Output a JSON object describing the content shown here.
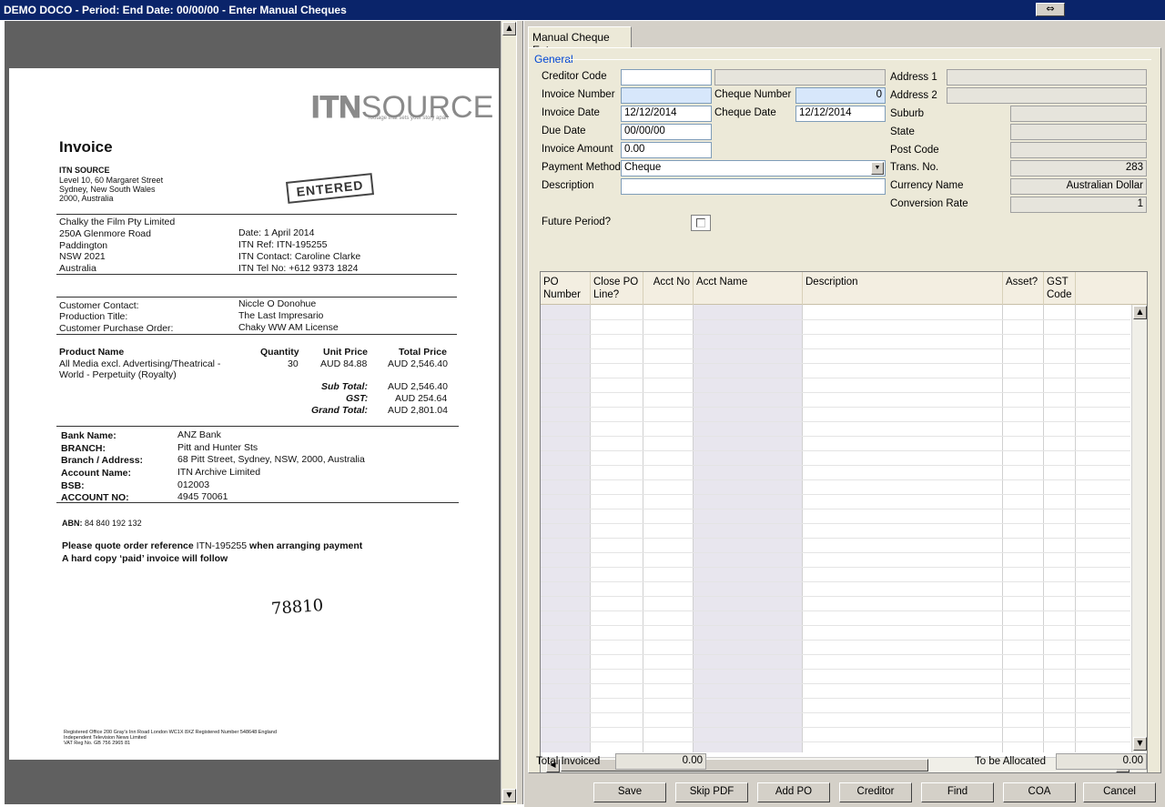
{
  "window": {
    "title": "DEMO DOCO  - Period:   End Date: 00/00/00 - Enter Manual Cheques",
    "swap_icon": "⇔"
  },
  "pdf": {
    "logo_itn": "ITN",
    "logo_source": "SOURCE",
    "logo_tagline": "footage that sets your story apart",
    "heading": "Invoice",
    "company": "ITN SOURCE",
    "company_addr": [
      "Level 10, 60 Margaret Street",
      "Sydney, New South Wales",
      "2000, Australia"
    ],
    "stamp": "ENTERED",
    "billto": [
      "Chalky the Film Pty Limited",
      "250A Glenmore Road",
      "Paddington",
      "NSW 2021",
      "Australia"
    ],
    "meta": [
      "Date: 1 April 2014",
      "ITN Ref: ITN-195255",
      "ITN Contact: Caroline Clarke",
      "ITN Tel No: +612 9373 1824"
    ],
    "contact_labels": [
      "Customer Contact:",
      "Production Title:",
      "Customer Purchase Order:"
    ],
    "contact_values": [
      "Niccle O Donohue",
      "The Last Impresario",
      "Chaky WW AM License"
    ],
    "product_headers": [
      "Product Name",
      "Quantity",
      "Unit Price",
      "Total Price"
    ],
    "product_name": [
      "All Media excl. Advertising/Theatrical -",
      "World - Perpetuity (Royalty)"
    ],
    "product_qty": "30",
    "product_unit": "AUD 84.88",
    "product_total": "AUD 2,546.40",
    "totals_labels": [
      "Sub Total:",
      "GST:",
      "Grand Total:"
    ],
    "totals_values": [
      "AUD 2,546.40",
      "AUD 254.64",
      "AUD 2,801.04"
    ],
    "bank_labels": [
      "Bank Name:",
      "BRANCH:",
      "Branch / Address:",
      "Account Name:",
      "BSB:",
      "ACCOUNT NO:"
    ],
    "bank_values": [
      "ANZ Bank",
      "Pitt and Hunter Sts",
      "68 Pitt Street, Sydney, NSW, 2000, Australia",
      "ITN Archive Limited",
      "012003",
      "4945 70061"
    ],
    "abn_label": "ABN:",
    "abn": "84 840 192 132",
    "note1_a": "Please quote order reference ",
    "note1_b": "ITN-195255",
    "note1_c": " when arranging payment",
    "note2": "A hard copy ‘paid’ invoice will follow",
    "handwritten": "78810",
    "footer": [
      "Registered Office 200 Gray's Inn Road London WC1X 8XZ  Registered Number 548648 England",
      "Independent Television News Limited",
      "VAT Reg No. GB 756 2965 81"
    ]
  },
  "form": {
    "tab_label": "Manual Cheque Entry",
    "group_label": "General",
    "creditor_code": {
      "label": "Creditor Code",
      "value": "",
      "name": ""
    },
    "invoice_number": {
      "label": "Invoice Number",
      "value": ""
    },
    "cheque_number": {
      "label": "Cheque Number",
      "value": "0"
    },
    "invoice_date": {
      "label": "Invoice Date",
      "value": "12/12/2014"
    },
    "cheque_date": {
      "label": "Cheque Date",
      "value": "12/12/2014"
    },
    "due_date": {
      "label": "Due Date",
      "value": "00/00/00"
    },
    "invoice_amount": {
      "label": "Invoice Amount",
      "value": "0.00"
    },
    "payment_method": {
      "label": "Payment Method",
      "value": "Cheque"
    },
    "description": {
      "label": "Description",
      "value": ""
    },
    "future_period": {
      "label": "Future Period?"
    },
    "address1": {
      "label": "Address 1",
      "value": ""
    },
    "address2": {
      "label": "Address 2",
      "value": ""
    },
    "suburb": {
      "label": "Suburb",
      "value": ""
    },
    "state": {
      "label": "State",
      "value": ""
    },
    "post_code": {
      "label": "Post Code",
      "value": ""
    },
    "trans_no": {
      "label": "Trans. No.",
      "value": "283"
    },
    "currency_name": {
      "label": "Currency Name",
      "value": "Australian Dollar"
    },
    "conversion_rate": {
      "label": "Conversion Rate",
      "value": "1"
    }
  },
  "grid": {
    "columns": [
      {
        "line1": "PO",
        "line2": "Number"
      },
      {
        "line1": "Close PO",
        "line2": "Line?"
      },
      {
        "line1": "Acct No",
        "line2": ""
      },
      {
        "line1": "Acct Name",
        "line2": ""
      },
      {
        "line1": "Description",
        "line2": ""
      },
      {
        "line1": "Asset?",
        "line2": ""
      },
      {
        "line1": "GST",
        "line2": "Code"
      }
    ]
  },
  "footer": {
    "total_invoiced_label": "Total Invoiced",
    "total_invoiced": "0.00",
    "to_be_allocated_label": "To be Allocated",
    "to_be_allocated": "0.00"
  },
  "buttons": {
    "save": "Save",
    "skip_pdf": "Skip PDF",
    "add_po": "Add PO",
    "creditor": "Creditor",
    "find": "Find",
    "coa": "COA",
    "cancel": "Cancel"
  },
  "icons": {
    "scroll_up": "▲",
    "scroll_down": "▼",
    "scroll_left": "◀",
    "scroll_right": "▶",
    "combo_arrow": "▼"
  },
  "colors": {
    "titlebar": "#0a246a",
    "required_field": "#d7e7fb",
    "group_label": "#0046d5"
  }
}
